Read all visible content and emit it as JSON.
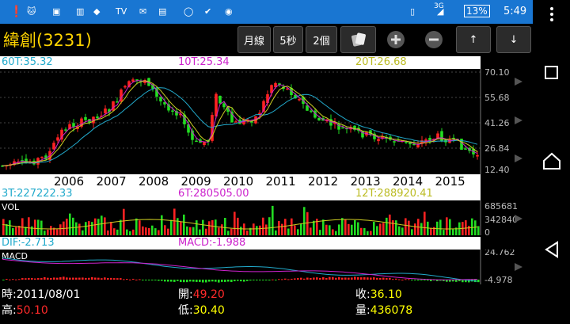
{
  "status": {
    "battery": "13%",
    "time": "5:49",
    "network": "3G"
  },
  "header": {
    "title": "緯創(3231)",
    "buttons": [
      "月線",
      "5秒",
      "2個"
    ],
    "up_label": "↑",
    "down_label": "↓"
  },
  "ma_bar": {
    "ma60": "60T:35.32",
    "ma10": "10T:25.34",
    "ma20": "20T:26.68"
  },
  "price_axis": [
    "70.10",
    "55.68",
    "41.26",
    "26.84",
    "12.40"
  ],
  "years": [
    "2006",
    "2007",
    "2008",
    "2009",
    "2010",
    "2011",
    "2012",
    "2013",
    "2014",
    "2015"
  ],
  "vol_bar": {
    "v3": "3T:227222.33",
    "v6": "6T:280505.00",
    "v12": "12T:288920.41"
  },
  "vol_label": "VOL",
  "vol_axis": [
    "685681",
    "342840",
    "0"
  ],
  "macd_bar": {
    "dif": "DIF:-2.713",
    "macd": "MACD:-1.988"
  },
  "macd_label": "MACD",
  "macd_axis": [
    "24.762",
    "-4.978"
  ],
  "footer": {
    "time_label": "時:",
    "time_value": "2011/08/01",
    "open_label": "開:",
    "open_value": "49.20",
    "close_label": "收:",
    "close_value": "36.10",
    "high_label": "高:",
    "high_value": "50.10",
    "low_label": "低:",
    "low_value": "30.40",
    "volume_label": "量:",
    "volume_value": "436078"
  },
  "colors": {
    "up": "#ff2222",
    "down": "#22dd22",
    "ma60": "#22aacc",
    "ma10": "#cc22cc",
    "ma20": "#cccc22"
  },
  "chart_data": {
    "type": "candlestick",
    "price_range": [
      12.4,
      70.1
    ],
    "x_tick_labels": [
      "2006",
      "2007",
      "2008",
      "2009",
      "2010",
      "2011",
      "2012",
      "2013",
      "2014",
      "2015"
    ],
    "series": [
      {
        "name": "60T",
        "value": 35.32
      },
      {
        "name": "10T",
        "value": 25.34
      },
      {
        "name": "20T",
        "value": 26.68
      }
    ]
  }
}
